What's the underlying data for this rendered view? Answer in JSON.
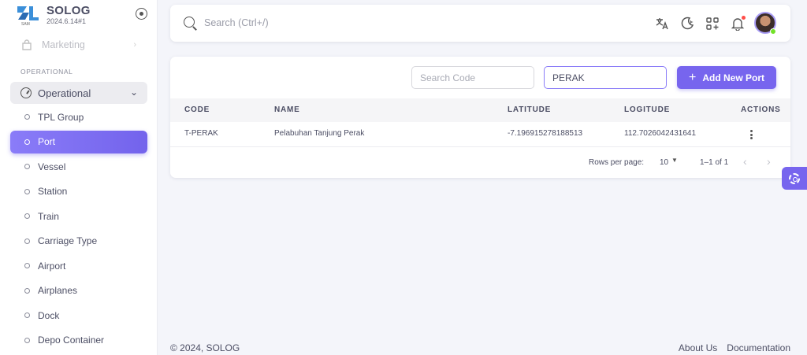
{
  "brand": {
    "name": "SOLOG",
    "version": "2024.6.14#1"
  },
  "sidebar": {
    "faded_item": "Marketing",
    "section_label": "OPERATIONAL",
    "group_label": "Operational",
    "items": [
      {
        "label": "TPL Group",
        "active": false
      },
      {
        "label": "Port",
        "active": true
      },
      {
        "label": "Vessel",
        "active": false
      },
      {
        "label": "Station",
        "active": false
      },
      {
        "label": "Train",
        "active": false
      },
      {
        "label": "Carriage Type",
        "active": false
      },
      {
        "label": "Airport",
        "active": false
      },
      {
        "label": "Airplanes",
        "active": false
      },
      {
        "label": "Dock",
        "active": false
      },
      {
        "label": "Depo Container",
        "active": false
      }
    ]
  },
  "topbar": {
    "search_placeholder": "Search (Ctrl+/)"
  },
  "filters": {
    "code_placeholder": "Search Code",
    "name_value": "PERAK"
  },
  "add_button": {
    "label": "Add New Port"
  },
  "table": {
    "headers": {
      "code": "CODE",
      "name": "NAME",
      "latitude": "LATITUDE",
      "longitude": "LOGITUDE",
      "actions": "ACTIONS"
    },
    "rows": [
      {
        "code": "T-PERAK",
        "name": "Pelabuhan Tanjung Perak",
        "latitude": "-7.196915278188513",
        "longitude": "112.7026042431641"
      }
    ]
  },
  "pagination": {
    "rows_per_page_label": "Rows per page:",
    "rows_per_page": "10",
    "range": "1–1 of 1"
  },
  "footer": {
    "copyright": "© 2024, SOLOG",
    "about": "About Us",
    "docs": "Documentation"
  },
  "colors": {
    "primary": "#7765ee",
    "notification": "#ff4d49",
    "online": "#72e128"
  }
}
